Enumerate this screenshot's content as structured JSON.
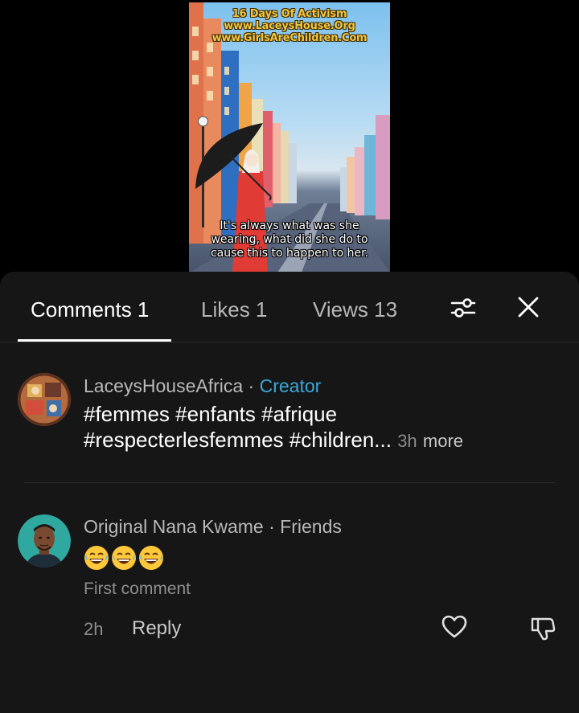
{
  "video": {
    "overlay_lines": [
      "16 Days Of Activism",
      "www.LaceysHouse.Org",
      "www.GirlsAreChildren.Com"
    ],
    "caption": "It's always what was she wearing, what did she do to cause this to happen to her."
  },
  "tabs": [
    {
      "label": "Comments 1",
      "active": true
    },
    {
      "label": "Likes 1",
      "active": false
    },
    {
      "label": "Views 13",
      "active": false
    }
  ],
  "icons": {
    "filter": "sliders-icon",
    "close": "close-icon",
    "like": "heart-icon",
    "dislike": "thumbs-down-icon"
  },
  "comments": [
    {
      "username": "LaceysHouseAfrica",
      "separator": " · ",
      "badge": "Creator",
      "line1": "#femmes #enfants #afrique",
      "line2": "#respecterlesfemmes #children...",
      "time": "3h",
      "more_label": "more"
    },
    {
      "username": "Original Nana Kwame",
      "separator": " · ",
      "badge": "Friends",
      "emojis": [
        "😂",
        "😂",
        "😂"
      ],
      "subtext": "First comment",
      "time": "2h",
      "reply_label": "Reply"
    }
  ],
  "colors": {
    "sheet_bg": "#161616",
    "creator_badge": "#3aa7d9",
    "overlay_text": "#f4c640"
  }
}
